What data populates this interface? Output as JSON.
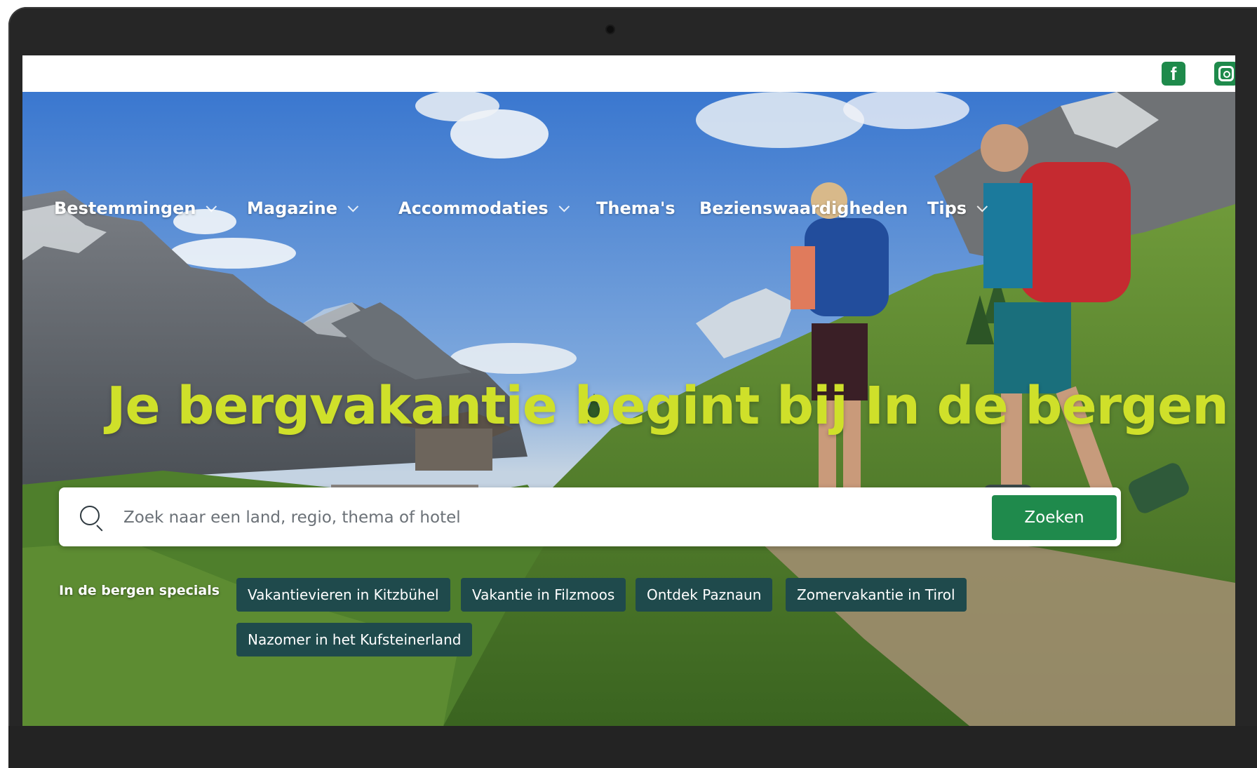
{
  "social": {
    "facebook_icon": "facebook-icon",
    "instagram_icon": "instagram-icon",
    "brand_color": "#1e8a4b"
  },
  "nav": {
    "items": [
      {
        "label": "Bestemmingen",
        "has_dropdown": true
      },
      {
        "label": "Magazine",
        "has_dropdown": true
      },
      {
        "label": "Accommodaties",
        "has_dropdown": true
      },
      {
        "label": "Thema's",
        "has_dropdown": false
      },
      {
        "label": "Bezienswaardigheden",
        "has_dropdown": false
      },
      {
        "label": "Tips",
        "has_dropdown": true
      }
    ]
  },
  "hero": {
    "headline": "Je bergvakantie begint bij In de bergen",
    "headline_color": "#cfe02a"
  },
  "search": {
    "placeholder": "Zoek naar een land, regio, thema of hotel",
    "value": "",
    "button_label": "Zoeken",
    "button_color": "#1f8a4c"
  },
  "specials": {
    "label": "In de bergen specials",
    "chips": [
      "Vakantievieren in Kitzbühel",
      "Vakantie in Filzmoos",
      "Ontdek Paznaun",
      "Zomervakantie in Tirol",
      "Nazomer in het Kufsteinerland"
    ],
    "chip_color": "#1f4a4c"
  }
}
